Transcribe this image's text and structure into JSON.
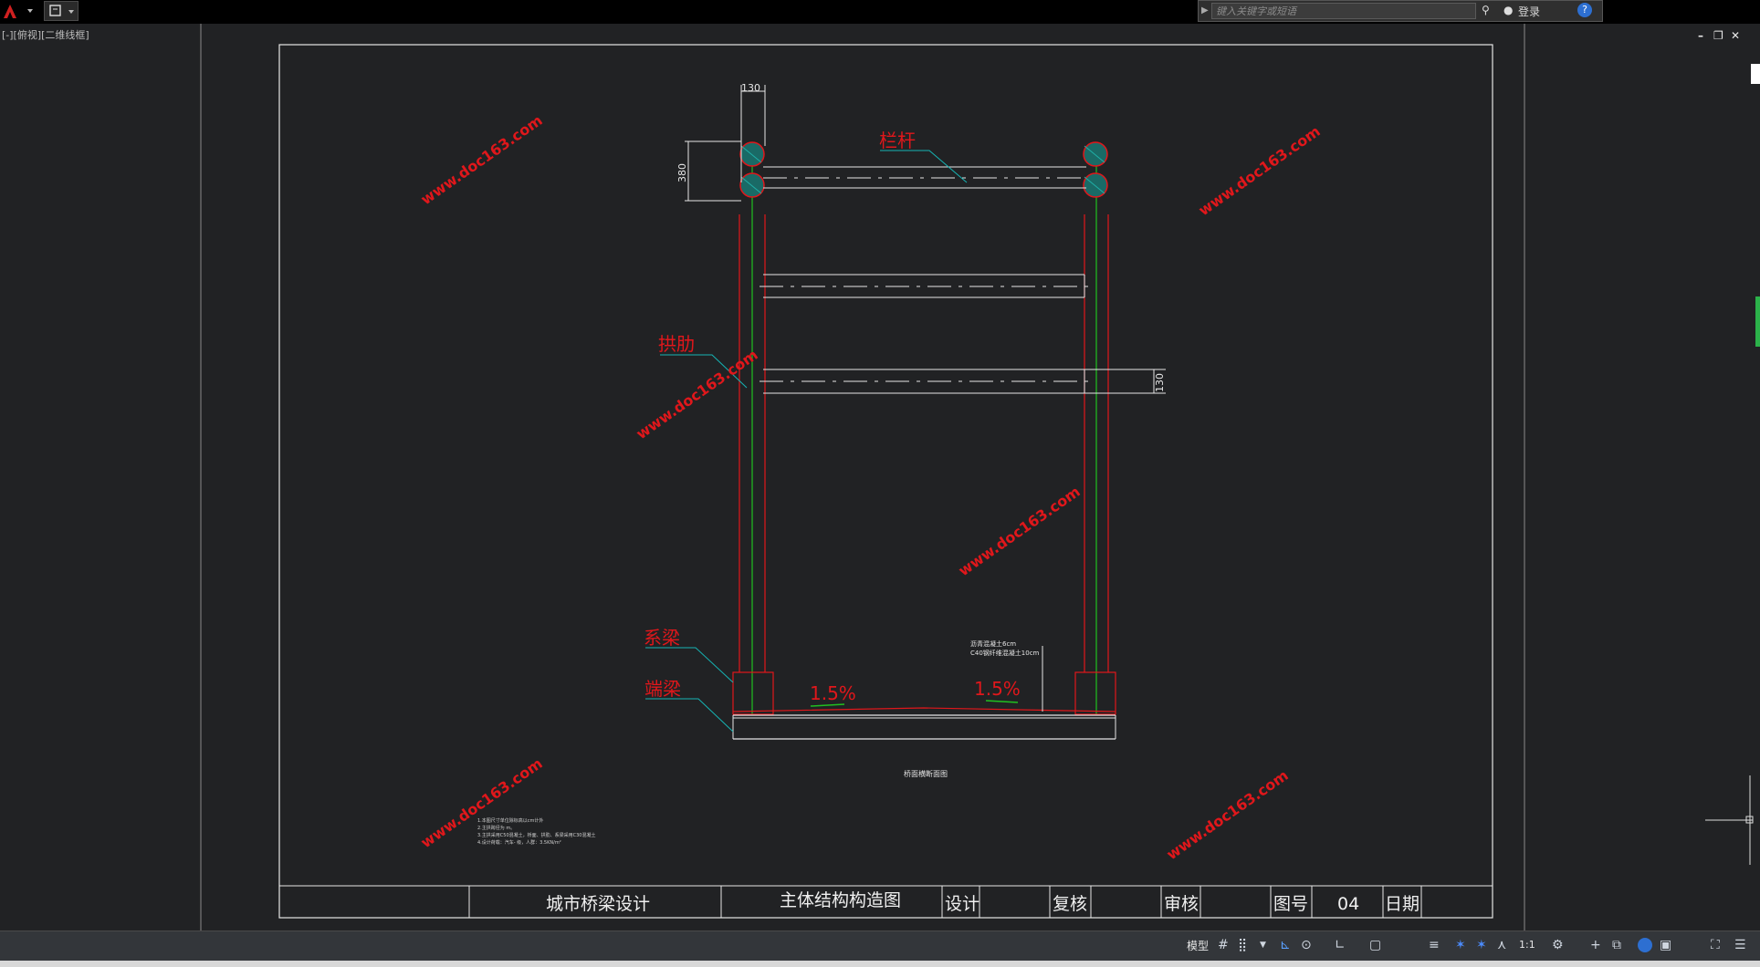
{
  "toolbar": {
    "search_placeholder": "键入关键字或短语",
    "login_label": "登录"
  },
  "viewport": {
    "label": "[-][俯视][二维线框]"
  },
  "drawing": {
    "dim_top": "130",
    "dim_left": "380",
    "dim_right": "130",
    "label_handrail": "栏杆",
    "label_arch_rib": "拱肋",
    "label_tie_beam": "系梁",
    "label_end_beam": "端梁",
    "slope_left": "1.5%",
    "slope_right": "1.5%",
    "pavement_note_1": "沥青混凝土6cm",
    "pavement_note_2": "C40钢纤维混凝土10cm",
    "section_caption": "桥面横断面图",
    "notes": [
      "1.本图尺寸单位除标高以cm计外",
      "2.主拱跨径为 m。",
      "3.主拱采用C50混凝土，桥面、拱肋、系梁采用C30混凝土",
      "4.设计荷载：汽车- 级，人群：3.5KN/m²"
    ],
    "watermark": "www.doc163.com"
  },
  "title_block": {
    "project": "城市桥梁设计",
    "drawing_name": "主体结构构造图",
    "design_label": "设计",
    "check_label": "复核",
    "review_label": "审核",
    "drawing_no_label": "图号",
    "drawing_no": "04",
    "date_label": "日期"
  },
  "statusbar": {
    "model_label": "模型",
    "scale_label": "1:1"
  },
  "colors": {
    "background": "#212224",
    "red_line": "#e0171b",
    "green_line": "#20c020",
    "cyan_leader": "#16b4b4",
    "white_line": "#e6e6e6",
    "hatch": "#1fb0a8",
    "watermark": "#e0171b"
  }
}
